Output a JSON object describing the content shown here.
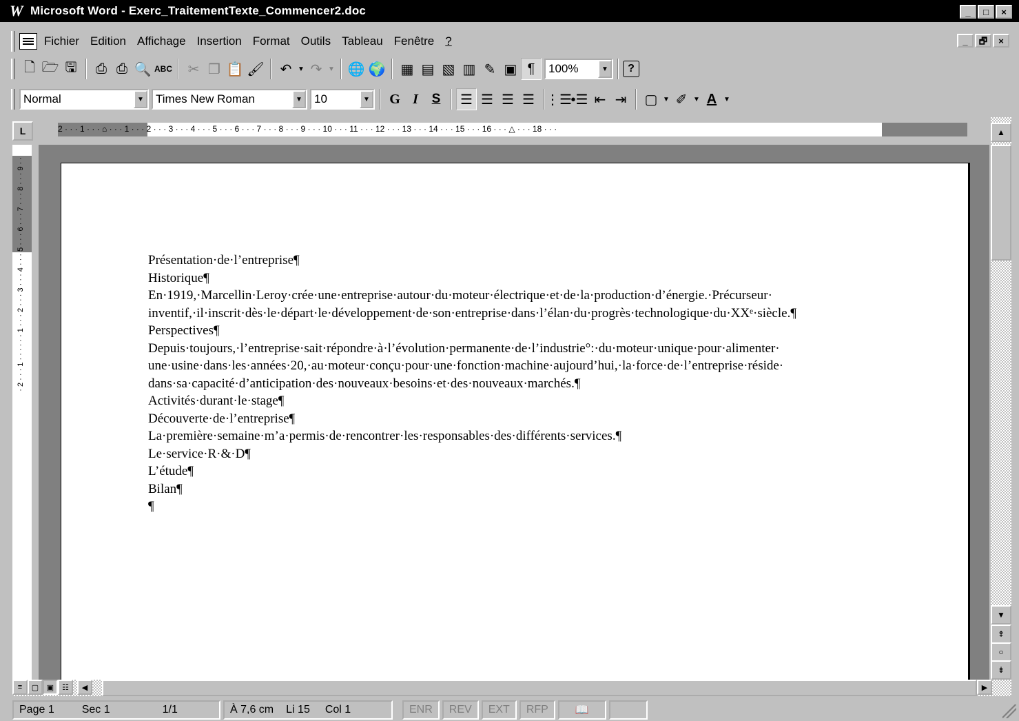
{
  "window": {
    "title": "Microsoft Word - Exerc_TraitementTexte_Commencer2.doc",
    "app_icon_letter": "W",
    "controls": [
      "_",
      "□",
      "×"
    ],
    "mdi_controls": [
      "_",
      "🗗",
      "×"
    ]
  },
  "menu": {
    "items": [
      "Fichier",
      "Edition",
      "Affichage",
      "Insertion",
      "Format",
      "Outils",
      "Tableau",
      "Fenêtre",
      "?"
    ]
  },
  "toolbar_standard": {
    "zoom": "100%",
    "icons": [
      "new-document-icon",
      "open-icon",
      "save-icon",
      "print-icon",
      "print-icon-2",
      "print-preview-icon",
      "spelling-icon",
      "cut-icon",
      "copy-icon",
      "paste-icon",
      "format-painter-icon",
      "undo-icon",
      "redo-icon",
      "hyperlink-icon",
      "web-toolbar-icon",
      "tables-borders-icon",
      "insert-table-icon",
      "insert-excel-icon",
      "columns-icon",
      "drawing-icon",
      "document-map-icon",
      "show-hide-icon",
      "help-icon"
    ]
  },
  "toolbar_format": {
    "style": "Normal",
    "font": "Times New Roman",
    "size": "10",
    "bold_label": "G",
    "italic_label": "I",
    "underline_label": "S",
    "font_color_label": "A"
  },
  "ruler": {
    "horizontal": "2 · · · 1 · · · ⌂ · · · 1 · · · 2 · · · 3 · · · 4 · · · 5 · · · 6 · · · 7 · · · 8 · · · 9 · · · 10 · · · 11 · · · 12 · · · 13 · · · 14 · · · 15 · · · 16 · · · △ · · · 18 · · ·",
    "vertical": "· 2 · · · 1 · · · · · · 1 · · · 2 · · · 3 · · · 4 · · · 5 · · · 6 · · · 7 · · · 8 · · · 9 · ·"
  },
  "document": {
    "lines": [
      "Présentation·de·l’entreprise¶",
      "Historique¶",
      "En·1919,·Marcellin·Leroy·crée·une·entreprise·autour·du·moteur·électrique·et·de·la·production·d’énergie.·Précurseur·",
      "inventif,·il·inscrit·dès·le·départ·le·développement·de·son·entreprise·dans·l’élan·du·progrès·technologique·du·XXᵉ·siècle.¶",
      "Perspectives¶",
      "Depuis·toujours,·l’entreprise·sait·répondre·à·l’évolution·permanente·de·l’industrie°:·du·moteur·unique·pour·alimenter·",
      "une·usine·dans·les·années·20,·au·moteur·conçu·pour·une·fonction·machine·aujourd’hui,·la·force·de·l’entreprise·réside·",
      "dans·sa·capacité·d’anticipation·des·nouveaux·besoins·et·des·nouveaux·marchés.¶",
      "Activités·durant·le·stage¶",
      "Découverte·de·l’entreprise¶",
      "La·première·semaine·m’a·permis·de·rencontrer·les·responsables·des·différents·services.¶",
      "Le·service·R·&·D¶",
      "L’étude¶",
      "Bilan¶",
      "¶"
    ]
  },
  "statusbar": {
    "page": "Page 1",
    "sec": "Sec 1",
    "pages": "1/1",
    "position": "À 7,6 cm",
    "line": "Li 15",
    "col": "Col 1",
    "enr": "ENR",
    "rev": "REV",
    "ext": "EXT",
    "rfp": "RFP"
  }
}
